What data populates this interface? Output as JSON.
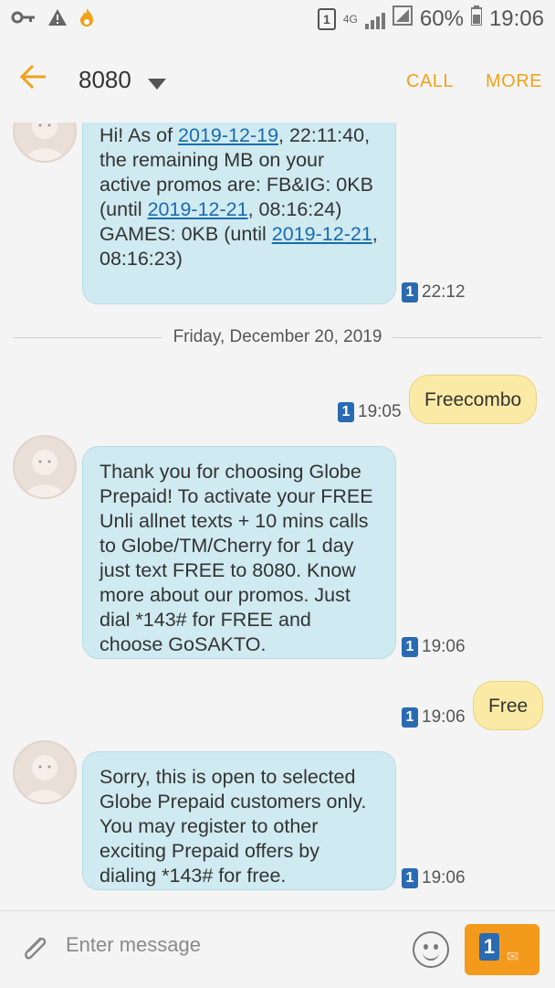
{
  "status_bar": {
    "network": "4G",
    "battery": "60%",
    "time": "19:06",
    "icons": [
      "key-icon",
      "warning-icon",
      "flame-icon",
      "sim-icon",
      "signal-icon",
      "battery-icon"
    ]
  },
  "app_bar": {
    "title": "8080",
    "call_label": "CALL",
    "more_label": "MORE"
  },
  "messages": [
    {
      "direction": "in",
      "text_parts": {
        "p1": "Hi! As of ",
        "date1": "2019-12-19",
        "p2": ", 22:11:40, the remaining MB on your active promos are: FB&IG: 0KB (until ",
        "date2": "2019-12-21",
        "p3": ", 08:16:24) GAMES: 0KB (until ",
        "date3": "2019-12-21",
        "p4": ", 08:16:23)"
      },
      "sim": "1",
      "time": "22:12"
    },
    {
      "divider": "Friday, December 20, 2019"
    },
    {
      "direction": "out",
      "text": "Freecombo",
      "sim": "1",
      "time": "19:05"
    },
    {
      "direction": "in",
      "text": "Thank you for choosing Globe Prepaid! To activate your FREE Unli allnet texts + 10 mins calls to Globe/TM/Cherry for 1 day just text FREE to 8080. Know more about our promos. Just dial *143# for FREE and choose GoSAKTO.",
      "sim": "1",
      "time": "19:06"
    },
    {
      "direction": "out",
      "text": "Free",
      "sim": "1",
      "time": "19:06"
    },
    {
      "direction": "in",
      "text": "Sorry, this is open to selected Globe Prepaid customers only. You may register to other exciting Prepaid offers by dialing *143# for free.",
      "sim": "1",
      "time": "19:06"
    }
  ],
  "compose": {
    "placeholder": "Enter message",
    "send_sim": "1"
  },
  "colors": {
    "accent": "#f0a21a",
    "incoming_bubble": "#cfeaf0",
    "outgoing_bubble": "#faeaa5",
    "sim_badge": "#2a6ab2"
  }
}
